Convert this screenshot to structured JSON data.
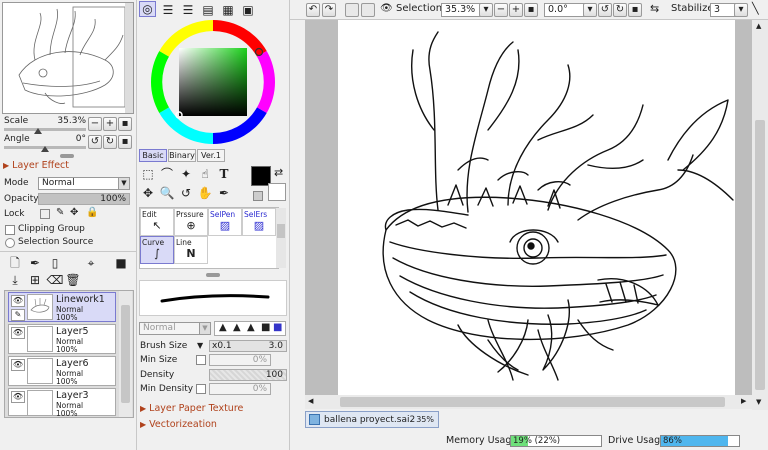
{
  "navigator": {
    "scale_label": "Scale",
    "scale_value": "35.3%",
    "angle_label": "Angle",
    "angle_value": "0°"
  },
  "layer_effect": {
    "header": "Layer Effect",
    "mode_label": "Mode",
    "mode_value": "Normal",
    "opacity_label": "Opacity",
    "opacity_value": "100%",
    "opacity_fraction": 1.0,
    "lock_label": "Lock",
    "clipping_group": "Clipping Group",
    "selection_source": "Selection Source"
  },
  "layers": [
    {
      "name": "Linework1",
      "mode": "Normal",
      "opacity": "100%",
      "selected": true
    },
    {
      "name": "Layer5",
      "mode": "Normal",
      "opacity": "100%",
      "selected": false
    },
    {
      "name": "Layer6",
      "mode": "Normal",
      "opacity": "100%",
      "selected": false
    },
    {
      "name": "Layer3",
      "mode": "Normal",
      "opacity": "100%",
      "selected": false
    }
  ],
  "color_tabs": [
    "Basic",
    "Binary",
    "Ver.1"
  ],
  "brush_tabs": [
    "Edit",
    "Prssure",
    "SelPen",
    "SelErs"
  ],
  "brush_items": [
    "Curve",
    "Line"
  ],
  "brush": {
    "blend_mode": "Normal",
    "size_label": "Brush Size",
    "size_multiplier": "x0.1",
    "size_value": "3.0",
    "min_size_label": "Min Size",
    "min_size_value": "0%",
    "density_label": "Density",
    "density_value": "100",
    "min_density_label": "Min Density",
    "min_density_value": "0%"
  },
  "sections": {
    "paper_texture": "Layer Paper Texture",
    "vectorization": "Vectorizeation"
  },
  "toolbar": {
    "selection_label": "Selection",
    "zoom_value": "35.3%",
    "rotation_value": "0.0°",
    "stabilizer_label": "Stabilizer",
    "stabilizer_value": "3"
  },
  "file_tab": {
    "name": "ballena proyect.sai2",
    "zoom": "35%"
  },
  "status": {
    "memory_label": "Memory Usage",
    "memory_value": "19% (22%)",
    "memory_fraction": 0.19,
    "drive_label": "Drive Usage",
    "drive_value": "86%",
    "drive_fraction": 0.86
  },
  "colors": {
    "accent_selected": "#d9daf7",
    "section_header": "#b0421c",
    "memory_fill": "#6ee07a",
    "drive_fill": "#4fb6ee",
    "current_color": "#000000"
  }
}
